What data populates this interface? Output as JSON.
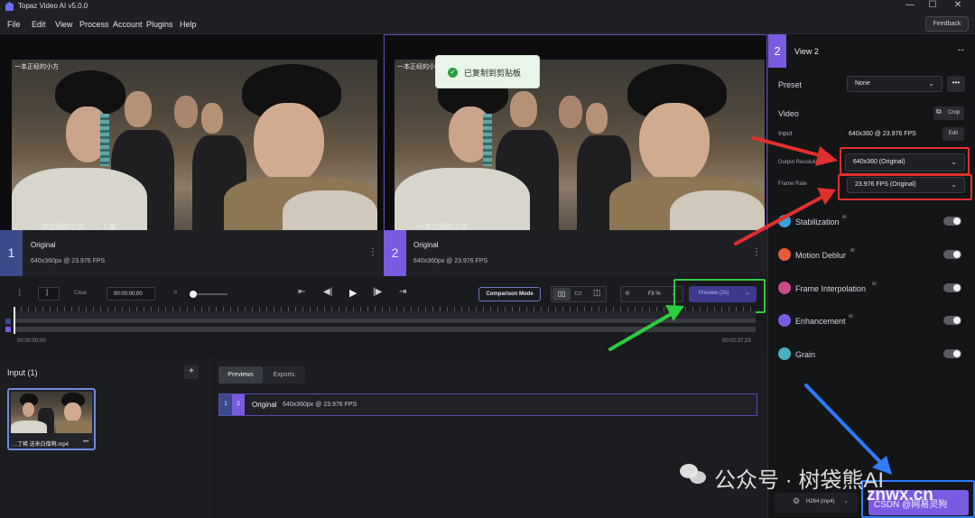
{
  "app": {
    "title": "Topaz Video AI  v5.0.0",
    "feedback": "Feedback"
  },
  "menu": [
    "File",
    "Edit",
    "View",
    "Process",
    "Account",
    "Plugins",
    "Help"
  ],
  "window_controls": [
    "—",
    "☐",
    "✕"
  ],
  "viewers": [
    {
      "num": "1",
      "title": "Original",
      "sub": "640x360px @ 23.976 FPS",
      "caption_top": "一本正经的小方",
      "caption_bottom": "一本正经的小方 丶丨丨串"
    },
    {
      "num": "2",
      "title": "Original",
      "sub": "640x360px @ 23.976 FPS",
      "caption_top": "一本正经的小方",
      "caption_bottom": "一本正经的小方"
    }
  ],
  "toast": {
    "text": "已复制到剪贴板"
  },
  "controls": {
    "bracket_open": "[",
    "bracket_close": "]",
    "clear": "Clear",
    "timecode": "00:00:00;00",
    "comparison": "Comparison Mode",
    "fit": "Fit %",
    "preview": "Preview (2s)"
  },
  "timeline": {
    "start": "00:00:00;00",
    "end": "00:02:37;23"
  },
  "input_panel": {
    "title": "Input (1)",
    "add": "+",
    "file": "...丁稀 送来白僧啊.mp4",
    "file_more": "•••"
  },
  "output_panel": {
    "tabs": [
      "Previews",
      "Exports"
    ],
    "row": {
      "a": "1",
      "b": "2",
      "title": "Original",
      "sub": "640x360px @ 23.976 FPS"
    }
  },
  "sidebar": {
    "view_num": "2",
    "view_title": "View 2",
    "preset_label": "Preset",
    "preset_value": "None",
    "video_label": "Video",
    "crop": "Crop",
    "input_label": "Input",
    "input_value": "640x360 @ 23.976 FPS",
    "edit": "Edit",
    "output_res_label": "Output Resolution",
    "output_res_value": "640x360 (Original)",
    "frame_rate_label": "Frame Rate",
    "frame_rate_value": "23.976 FPS (Original)",
    "features": [
      {
        "name": "Stabilization",
        "badge": "AI",
        "color": "#3aa0d8"
      },
      {
        "name": "Motion Deblur",
        "badge": "AI",
        "color": "#e45a3a"
      },
      {
        "name": "Frame Interpolation",
        "badge": "AI",
        "color": "#c84a8a"
      },
      {
        "name": "Enhancement",
        "badge": "AI",
        "color": "#7a5ae0"
      },
      {
        "name": "Grain",
        "badge": "",
        "color": "#4ab0c0"
      }
    ],
    "codec": "H264 (mp4)",
    "export": "CSDN @网易灵狗"
  },
  "watermark": {
    "text": "公众号 · 树袋熊AI",
    "site": "znwx.cn"
  },
  "colors": {
    "accent": "#7a5ae0",
    "view1": "#3b4a8a",
    "red": "#e0302d",
    "green": "#2ecc40",
    "blue": "#2f7cff"
  }
}
